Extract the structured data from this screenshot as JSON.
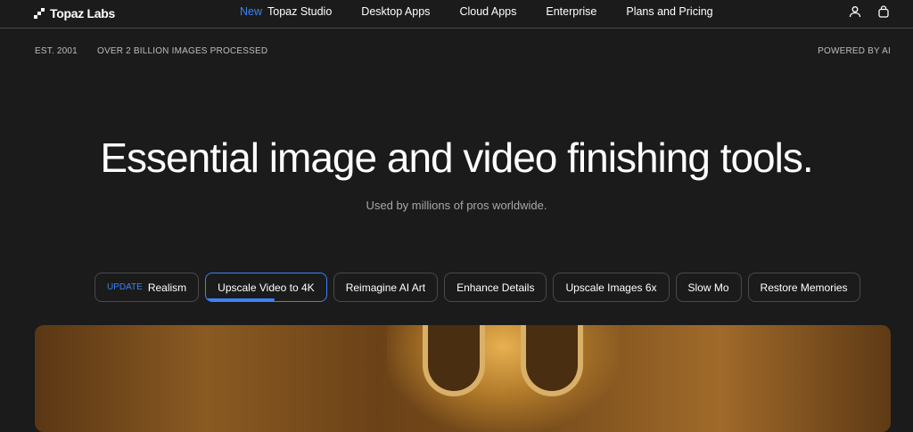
{
  "nav": {
    "brand": "Topaz Labs",
    "new_badge": "New",
    "items": [
      "Topaz Studio",
      "Desktop Apps",
      "Cloud Apps",
      "Enterprise",
      "Plans and Pricing"
    ]
  },
  "meta": {
    "est": "EST. 2001",
    "processed": "OVER 2 BILLION IMAGES PROCESSED",
    "powered": "POWERED BY AI"
  },
  "hero": {
    "title": "Essential image and video finishing tools.",
    "subtitle": "Used by millions of pros worldwide."
  },
  "tabs": {
    "update_badge": "UPDATE",
    "items": [
      "Realism",
      "Upscale Video to 4K",
      "Reimagine AI Art",
      "Enhance Details",
      "Upscale Images 6x",
      "Slow Mo",
      "Restore Memories"
    ],
    "active_index": 1,
    "active_progress": 0.57
  },
  "colors": {
    "accent": "#3b82f6",
    "background": "#1b1b1b"
  }
}
